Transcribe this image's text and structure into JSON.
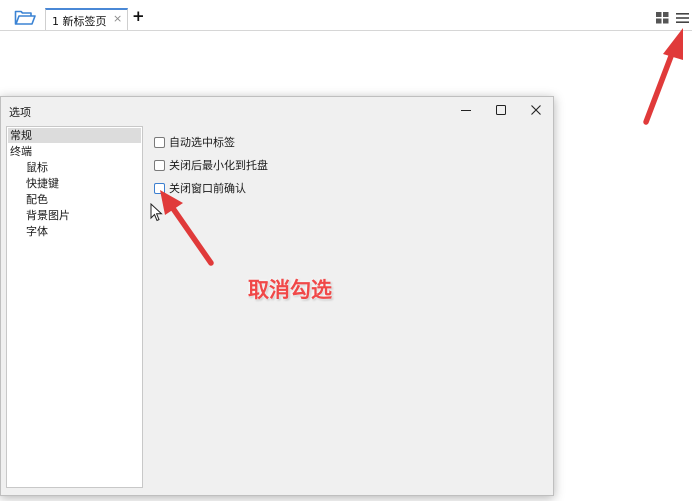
{
  "app_bar": {
    "folder_icon": "folder-open-icon",
    "tab": {
      "label": "1 新标签页",
      "close": "×"
    },
    "add_tab": "+",
    "grid_icon": "grid-icon",
    "menu_icon": "hamburger-menu-icon",
    "accent": "#4a88d6"
  },
  "dialog": {
    "title": "选项",
    "window_controls": {
      "minimize": "minimize-icon",
      "maximize": "maximize-icon",
      "close": "close-icon"
    },
    "tree": [
      {
        "label": "常规",
        "selected": true
      },
      {
        "label": "终端"
      },
      {
        "label": "鼠标"
      },
      {
        "label": "快捷键"
      },
      {
        "label": "配色"
      },
      {
        "label": "背景图片"
      },
      {
        "label": "字体"
      }
    ],
    "options": [
      {
        "label": "自动选中标签",
        "checked": false
      },
      {
        "label": "关闭后最小化到托盘",
        "checked": false
      },
      {
        "label": "关闭窗口前确认",
        "checked": false
      }
    ]
  },
  "annotation": {
    "text": "取消勾选",
    "color": "#f04848"
  }
}
